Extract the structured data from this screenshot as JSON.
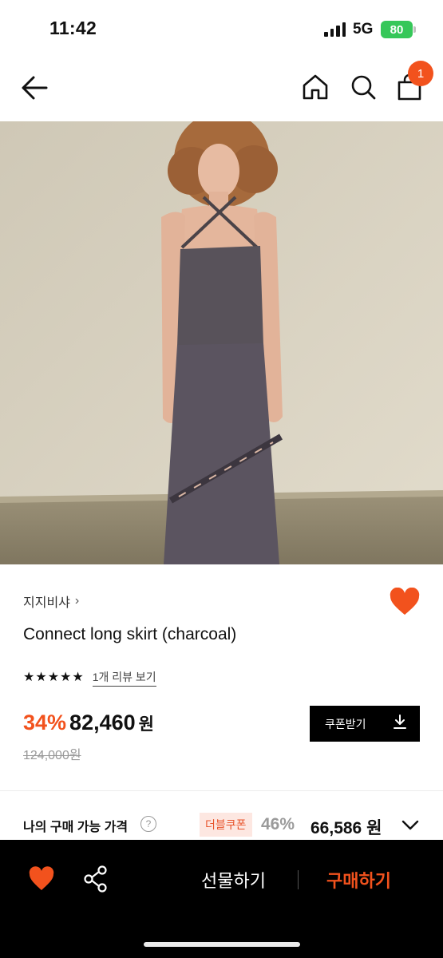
{
  "status_bar": {
    "time": "11:42",
    "network": "5G",
    "battery": "80"
  },
  "header": {
    "cart_count": "1"
  },
  "product": {
    "brand": "지지비샤",
    "title": "Connect long skirt (charcoal)",
    "review_link": "1개 리뷰 보기",
    "rating_stars": 5,
    "discount": "34%",
    "sale_price": "82,460",
    "price_unit": "원",
    "original_price": "124,000원",
    "coupon_button": "쿠폰받기"
  },
  "my_price": {
    "label": "나의 구매 가능 가격",
    "help_icon": "?",
    "double_coupon": "더블쿠폰",
    "discount": "46%",
    "price": "66,586",
    "unit": "원"
  },
  "bottom_bar": {
    "gift": "선물하기",
    "buy": "구매하기"
  },
  "colors": {
    "accent": "#f2521d",
    "battery": "#36c759"
  },
  "icons": [
    "back-arrow-icon",
    "home-icon",
    "search-icon",
    "shopping-bag-icon",
    "heart-icon",
    "share-icon",
    "download-icon",
    "chevron-down-icon"
  ]
}
